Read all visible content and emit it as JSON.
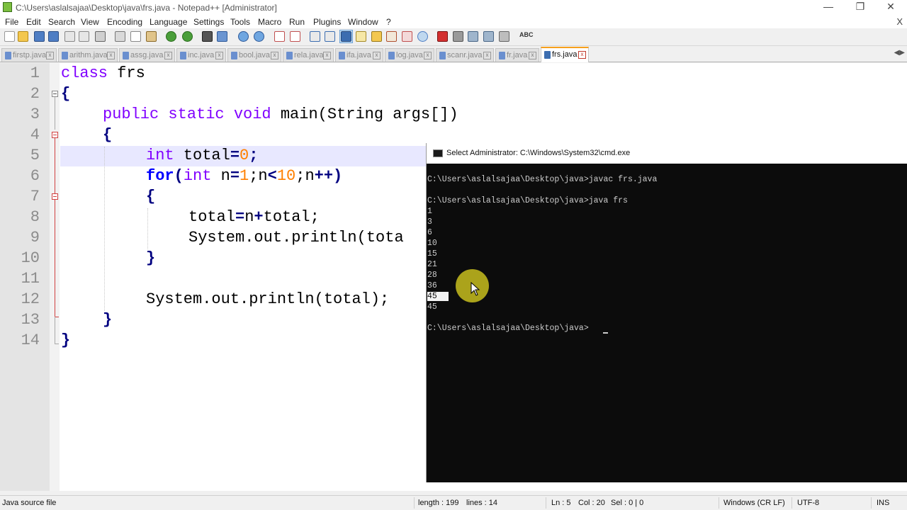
{
  "window": {
    "title": "C:\\Users\\aslalsajaa\\Desktop\\java\\frs.java - Notepad++ [Administrator]",
    "minimize": "—",
    "restore": "❐",
    "close": "✕"
  },
  "menu": {
    "items": [
      "File",
      "Edit",
      "Search",
      "View",
      "Encoding",
      "Language",
      "Settings",
      "Tools",
      "Macro",
      "Run",
      "Plugins",
      "Window",
      "?"
    ],
    "close": "X"
  },
  "toolbar": {
    "spell_label": "ABC",
    "icons": [
      "new-icon",
      "open-icon",
      "save-icon",
      "save-all-icon",
      "close-icon",
      "close-all-icon",
      "print-icon",
      "cut-icon",
      "copy-icon",
      "paste-icon",
      "undo-icon",
      "redo-icon",
      "find-icon",
      "replace-icon",
      "zoom-in-icon",
      "zoom-out-icon",
      "sync-vertical-icon",
      "sync-horizontal-icon",
      "word-wrap-icon",
      "show-all-chars-icon",
      "indent-guide-icon",
      "udl-icon",
      "doc-map-icon",
      "function-list-icon",
      "folder-workspace-icon",
      "monitor-icon",
      "record-macro-icon",
      "stop-macro-icon",
      "play-macro-icon",
      "run-macro-multiple-icon",
      "save-macro-icon",
      "spell-check-icon"
    ]
  },
  "tabs": [
    {
      "label": "firstp.java",
      "active": false
    },
    {
      "label": "arithm.java",
      "active": false
    },
    {
      "label": "assg.java",
      "active": false
    },
    {
      "label": "inc.java",
      "active": false
    },
    {
      "label": "bool.java",
      "active": false
    },
    {
      "label": "rela.java",
      "active": false
    },
    {
      "label": "ifa.java",
      "active": false
    },
    {
      "label": "log.java",
      "active": false
    },
    {
      "label": "scanr.java",
      "active": false
    },
    {
      "label": "fr.java",
      "active": false
    },
    {
      "label": "frs.java",
      "active": true
    }
  ],
  "tab_scroll": "◀▶",
  "editor": {
    "line_numbers": [
      "1",
      "2",
      "3",
      "4",
      "5",
      "6",
      "7",
      "8",
      "9",
      "10",
      "11",
      "12",
      "13",
      "14"
    ],
    "current_line": 5,
    "lines": [
      {
        "kw": "class",
        "rest": " frs"
      },
      {
        "text": "{"
      },
      {
        "kw": "public static void",
        "rest": " main(String args[])"
      },
      {
        "text": "{"
      },
      {
        "kw": "int",
        "a": " total",
        "op": "=",
        "num": "0",
        "end": ";"
      },
      {
        "kw": "for",
        "p1": "(",
        "kw2": "int",
        "a": " n",
        "op1": "=",
        "num1": "1",
        "b": ";n",
        "op2": "<",
        "num2": "10",
        "c": ";n",
        "op3": "++)"
      },
      {
        "text": "{"
      },
      {
        "a": "total",
        "op1": "=",
        "b": "n",
        "op2": "+",
        "c": "total;"
      },
      {
        "text": "System.out.println(tota"
      },
      {
        "text": "}"
      },
      {
        "text": ""
      },
      {
        "text": "System.out.println(total);"
      },
      {
        "text": "}"
      },
      {
        "text": "}"
      }
    ]
  },
  "console": {
    "title": "Select Administrator: C:\\Windows\\System32\\cmd.exe",
    "lines": [
      "C:\\Users\\aslalsajaa\\Desktop\\java>javac frs.java",
      "",
      "C:\\Users\\aslalsajaa\\Desktop\\java>java frs",
      "1",
      "3",
      "6",
      "10",
      "15",
      "21",
      "28",
      "36",
      "45",
      "45",
      "",
      "C:\\Users\\aslalsajaa\\Desktop\\java>"
    ],
    "selected_line_index": 11
  },
  "status": {
    "file_type": "Java source file",
    "length": "length : 199",
    "lines": "lines : 14",
    "ln": "Ln : 5",
    "col": "Col : 20",
    "sel": "Sel : 0 | 0",
    "eol": "Windows (CR LF)",
    "encoding": "UTF-8",
    "mode": "INS"
  }
}
